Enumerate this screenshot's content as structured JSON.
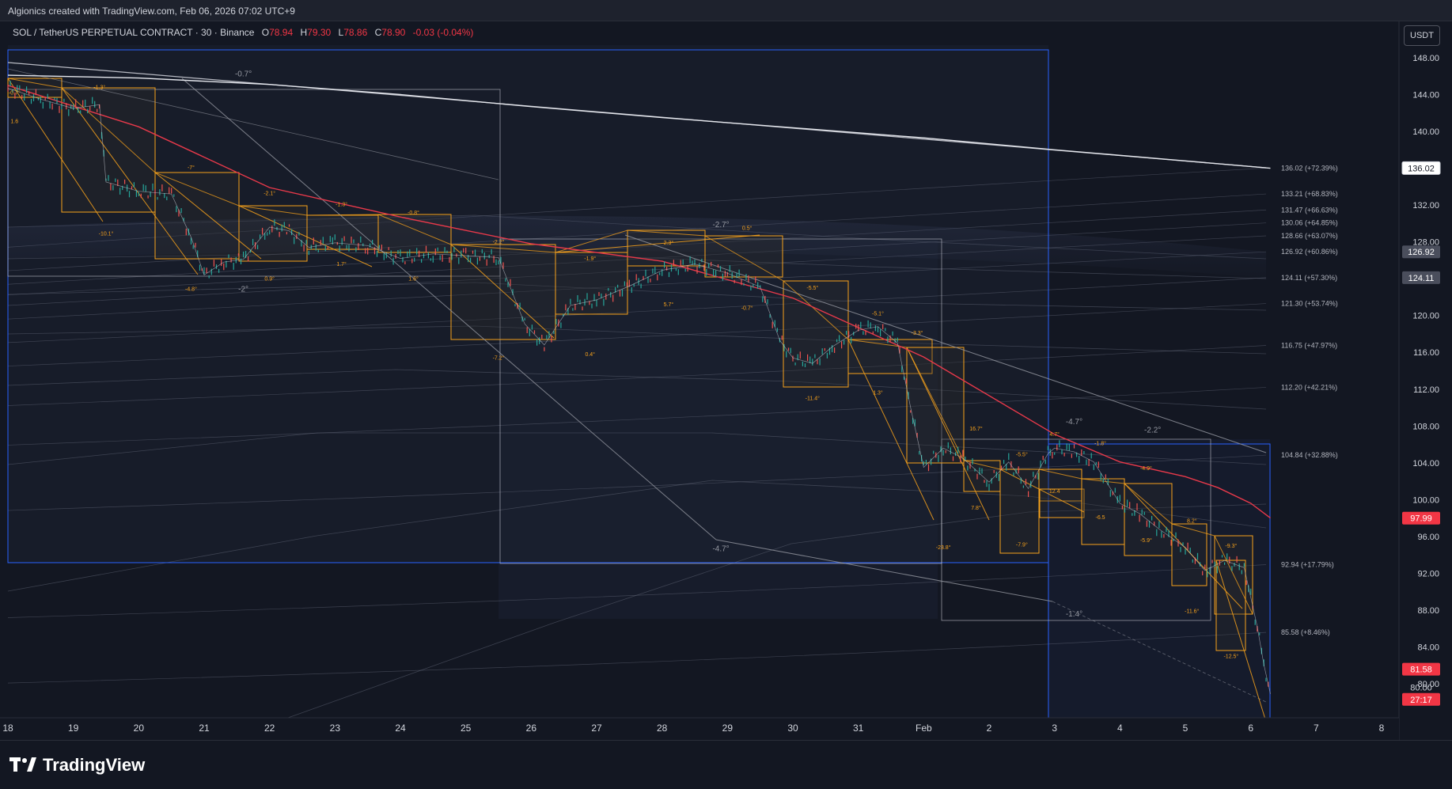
{
  "header": {
    "credit": "Algionics created with TradingView.com, Feb 06, 2026 07:02 UTC+9"
  },
  "legend": {
    "symbol": "SOL / TetherUS PERPETUAL CONTRACT · 30 · Binance",
    "open_label": "O",
    "open": "78.94",
    "high_label": "H",
    "high": "79.30",
    "low_label": "L",
    "low": "78.86",
    "close_label": "C",
    "close": "78.90",
    "change": "-0.03 (-0.04%)"
  },
  "currency_button": "USDT",
  "brand": {
    "name": "TradingView"
  },
  "colors": {
    "background": "#131722",
    "candle_up": "#26a69a",
    "candle_down": "#ef5350",
    "box_orange": "#f7a21b",
    "ema_red": "#e8394a",
    "ema_teal": "#26a69a",
    "blue_box": "#2962ff"
  },
  "chart_data": {
    "type": "line",
    "title": "SOL / TetherUS PERPETUAL CONTRACT · 30 · Binance",
    "ylim": [
      76,
      150
    ],
    "y_ticks": [
      "80.00",
      "84.00",
      "88.00",
      "92.00",
      "96.00",
      "100.00",
      "104.00",
      "108.00",
      "112.00",
      "116.00",
      "120.00",
      "124.00",
      "128.00",
      "132.00",
      "136.00",
      "140.00",
      "144.00",
      "148.00"
    ],
    "x_tick_labels": [
      "18",
      "19",
      "20",
      "21",
      "22",
      "23",
      "24",
      "25",
      "26",
      "27",
      "28",
      "29",
      "30",
      "31",
      "Feb",
      "2",
      "3",
      "4",
      "5",
      "6",
      "7",
      "8"
    ],
    "x_tick_values": [
      18,
      19,
      20,
      21,
      22,
      23,
      24,
      25,
      26,
      27,
      28,
      29,
      30,
      31,
      32,
      33,
      34,
      35,
      36,
      37,
      38,
      39
    ],
    "xlim": [
      18,
      39.4
    ],
    "series": [
      {
        "type": "price",
        "x": [
          18,
          18.5,
          19,
          19.4,
          19.5,
          20,
          20.5,
          20.8,
          21,
          21.3,
          21.6,
          22,
          22.3,
          22.6,
          23,
          23.5,
          24,
          24.5,
          25,
          25.5,
          25.9,
          26.2,
          26.6,
          27,
          27.5,
          28,
          28.5,
          29,
          29.5,
          29.8,
          30,
          30.3,
          30.6,
          31,
          31.3,
          31.6,
          31.8,
          32,
          32.3,
          32.6,
          33,
          33.3,
          33.6,
          33.9,
          34,
          34.3,
          34.6,
          35,
          35.3,
          35.6,
          36,
          36.3,
          36.6,
          36.9,
          37.1,
          37.2,
          37.3
        ],
        "values": [
          144.7,
          143.5,
          142.5,
          142.9,
          134.5,
          133.5,
          133.2,
          128.5,
          124.4,
          125.8,
          126.1,
          129.6,
          129.2,
          127.4,
          127.9,
          127.6,
          126.2,
          126.7,
          126.5,
          126.3,
          119.1,
          116.8,
          121.1,
          121.7,
          123.2,
          124.9,
          125.6,
          124.6,
          123.1,
          117.3,
          115.4,
          114.8,
          116.6,
          118.4,
          118.8,
          117.0,
          110.0,
          103.5,
          105.6,
          104.5,
          101.9,
          104.1,
          101.2,
          105.0,
          105.6,
          105.2,
          104.1,
          99.6,
          98.5,
          96.8,
          94.8,
          92.3,
          93.4,
          92.6,
          86.2,
          82.1,
          78.9
        ]
      },
      {
        "name": "",
        "x": [
          18,
          20,
          22,
          24,
          26,
          28,
          30,
          32,
          34,
          35,
          36,
          36.5,
          37,
          37.3
        ],
        "values": [
          145.0,
          140.5,
          133.9,
          130.7,
          127.8,
          125.9,
          121.9,
          115.5,
          107.1,
          104.1,
          102.5,
          101.3,
          99.6,
          98.0
        ]
      },
      {
        "name": "",
        "x": [
          18,
          20,
          22,
          24,
          26,
          28,
          30,
          32,
          34,
          36,
          37.3
        ],
        "values": [
          146.1,
          145.8,
          145.1,
          144.0,
          142.7,
          141.5,
          140.4,
          139.3,
          138.0,
          136.8,
          136.0
        ]
      }
    ],
    "level_lines": [
      {
        "label": "136.02 (+72.39%)",
        "value": 136.02
      },
      {
        "label": "133.21 (+68.83%)",
        "value": 133.21
      },
      {
        "label": "131.47 (+66.63%)",
        "value": 131.47
      },
      {
        "label": "130.06 (+64.85%)",
        "value": 130.06
      },
      {
        "label": "128.66 (+63.07%)",
        "value": 128.66
      },
      {
        "label": "126.92 (+60.86%)",
        "value": 126.92
      },
      {
        "label": "124.11 (+57.30%)",
        "value": 124.11
      },
      {
        "label": "121.30 (+53.74%)",
        "value": 121.3
      },
      {
        "label": "116.75 (+47.97%)",
        "value": 116.75
      },
      {
        "label": "112.20 (+42.21%)",
        "value": 112.2
      },
      {
        "label": "104.84 (+32.88%)",
        "value": 104.84
      },
      {
        "label": "92.94 (+17.79%)",
        "value": 92.94
      },
      {
        "label": "85.58 (+8.46%)",
        "value": 85.58
      }
    ],
    "price_badges": [
      {
        "text": "136.02",
        "value": 136.02,
        "style": "white"
      },
      {
        "text": "126.92",
        "value": 126.92,
        "style": "gray"
      },
      {
        "text": "124.11",
        "value": 124.11,
        "style": "gray"
      },
      {
        "text": "97.99",
        "value": 97.99,
        "style": "red"
      },
      {
        "text": "81.58",
        "value": 81.58,
        "style": "red"
      },
      {
        "text": "80.00",
        "value": 79.6,
        "style": "plain"
      },
      {
        "text": "27:17",
        "value": 78.3,
        "style": "red"
      }
    ],
    "angle_annotations": [
      {
        "text": "-0.7°",
        "x": 21.6,
        "y": 146.0
      },
      {
        "text": "-2°",
        "x": 21.6,
        "y": 122.6
      },
      {
        "text": "-2.7°",
        "x": 28.9,
        "y": 129.6
      },
      {
        "text": "-4.7°",
        "x": 28.9,
        "y": 94.4
      },
      {
        "text": "-4.7°",
        "x": 34.3,
        "y": 108.2
      },
      {
        "text": "-2.2°",
        "x": 35.5,
        "y": 107.3
      },
      {
        "text": "-1.4°",
        "x": 34.3,
        "y": 87.3
      }
    ],
    "box_annotations": [
      {
        "text": "-0.7°",
        "x": 18.1,
        "y": 144.0
      },
      {
        "text": "1.6",
        "x": 18.1,
        "y": 140.9
      },
      {
        "text": "-1.3°",
        "x": 19.4,
        "y": 144.6
      },
      {
        "text": "-10.1°",
        "x": 19.5,
        "y": 128.7
      },
      {
        "text": "-7°",
        "x": 20.8,
        "y": 135.9
      },
      {
        "text": "-4.8°",
        "x": 20.8,
        "y": 122.7
      },
      {
        "text": "-2.1°",
        "x": 22.0,
        "y": 133.1
      },
      {
        "text": "0.9°",
        "x": 22.0,
        "y": 123.8
      },
      {
        "text": "-1.3°",
        "x": 23.1,
        "y": 131.9
      },
      {
        "text": "1.7°",
        "x": 23.1,
        "y": 125.4
      },
      {
        "text": "-0.8°",
        "x": 24.2,
        "y": 131.0
      },
      {
        "text": "1.6°",
        "x": 24.2,
        "y": 123.8
      },
      {
        "text": "-2.2°",
        "x": 25.5,
        "y": 127.8
      },
      {
        "text": "-7.2°",
        "x": 25.5,
        "y": 115.2
      },
      {
        "text": "-1.9°",
        "x": 26.9,
        "y": 126.0
      },
      {
        "text": "0.4°",
        "x": 26.9,
        "y": 115.6
      },
      {
        "text": "2.3°",
        "x": 28.1,
        "y": 127.7
      },
      {
        "text": "5.7°",
        "x": 28.1,
        "y": 121.0
      },
      {
        "text": "0.5°",
        "x": 29.3,
        "y": 129.3
      },
      {
        "text": "-0.7°",
        "x": 29.3,
        "y": 120.6
      },
      {
        "text": "-5.5°",
        "x": 30.3,
        "y": 122.8
      },
      {
        "text": "-11.4°",
        "x": 30.3,
        "y": 110.8
      },
      {
        "text": "-5.1°",
        "x": 31.3,
        "y": 120.0
      },
      {
        "text": "1.3°",
        "x": 31.3,
        "y": 111.4
      },
      {
        "text": "-3.3°",
        "x": 31.9,
        "y": 117.9
      },
      {
        "text": "-23.8°",
        "x": 32.3,
        "y": 94.6
      },
      {
        "text": "16.7°",
        "x": 32.8,
        "y": 107.5
      },
      {
        "text": "7.8°",
        "x": 32.8,
        "y": 98.9
      },
      {
        "text": "-5.5°",
        "x": 33.5,
        "y": 104.7
      },
      {
        "text": "-7.9°",
        "x": 33.5,
        "y": 94.9
      },
      {
        "text": "4.7°",
        "x": 34.0,
        "y": 106.9
      },
      {
        "text": "12.4",
        "x": 34.0,
        "y": 100.7
      },
      {
        "text": "-1.8°",
        "x": 34.7,
        "y": 105.9
      },
      {
        "text": "-6.5",
        "x": 34.7,
        "y": 97.9
      },
      {
        "text": "-4.9°",
        "x": 35.4,
        "y": 103.2
      },
      {
        "text": "-5.9°",
        "x": 35.4,
        "y": 95.4
      },
      {
        "text": "8.2°",
        "x": 36.1,
        "y": 97.5
      },
      {
        "text": "-11.6°",
        "x": 36.1,
        "y": 87.7
      },
      {
        "text": "-9.3°",
        "x": 36.7,
        "y": 94.8
      },
      {
        "text": "-12.5°",
        "x": 36.7,
        "y": 82.8
      }
    ]
  }
}
